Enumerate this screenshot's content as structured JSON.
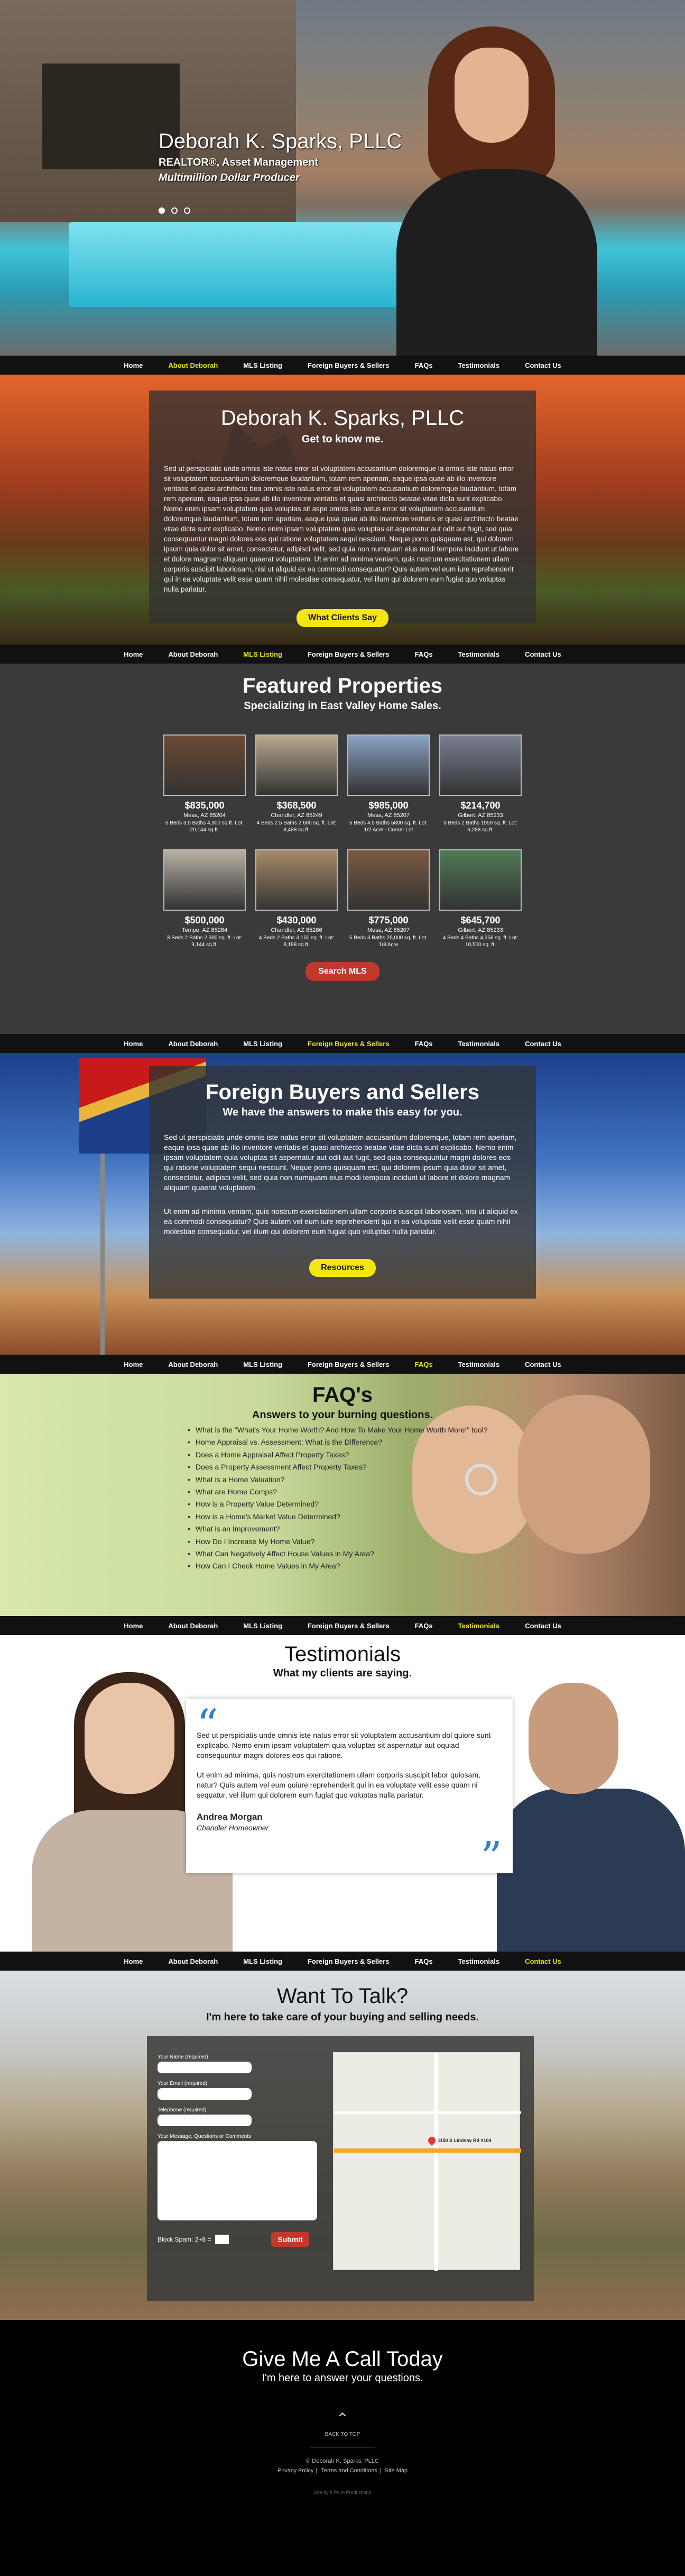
{
  "nav": [
    "Home",
    "About Deborah",
    "MLS Listing",
    "Foreign Buyers & Sellers",
    "FAQs",
    "Testimonials",
    "Contact Us"
  ],
  "hero": {
    "name": "Deborah K. Sparks, PLLC",
    "title": "REALTOR®, Asset Management",
    "tagline": "Multimillion Dollar Producer"
  },
  "about": {
    "heading": "Deborah K. Sparks, PLLC",
    "subheading": "Get to know me.",
    "body": "Sed ut perspiciatis unde omnis iste natus error sit voluptatem accusantium doloremque la omnis iste natus error sit voluptatem accusantium doloremque laudantium, totam rem aperiam, eaque ipsa quae ab illo inventore veritatis et quasi architecto bea omnis iste natus error sit voluptatem accusantium doloremque laudantium, totam rem aperiam, eaque ipsa quae ab illo inventore veritatis et quasi architecto beatae vitae dicta sunt explicabo. Nemo enim ipsam voluptatem quia voluptas sit aspe omnis iste natus error sit voluptatem accusantium doloremque laudantium, totam rem aperiam, eaque ipsa quae ab illo inventore veritatis et quasi architecto beatae vitae dicta sunt explicabo. Nemo enim ipsam voluptatem quia voluptas sit aspernatur aut odit aut fugit, sed quia consequuntur magni dolores eos qui ratione voluptatem sequi nesciunt. Neque porro quisquam est, qui dolorem ipsum quia dolor sit amet, consectetur, adipisci velit, sed quia non numquam eius modi tempora incidunt ut labore et dolore magnam aliquam quaerat voluptatem. Ut enim ad minima veniam, quis nostrum exercitationem ullam corporis suscipit laboriosam, nisi ut aliquid ex ea commodi consequatur? Quis autem vel eum iure reprehenderit qui in ea voluptate velit esse quam nihil molestiae consequatur, vel illum qui dolorem eum fugiat quo voluptas nulla pariatur.",
    "button": "What Clients Say"
  },
  "props": {
    "heading": "Featured Properties",
    "subheading": "Specializing in East Valley Home Sales.",
    "button": "Search MLS",
    "items": [
      {
        "price": "$835,000",
        "addr": "Mesa, AZ 85204",
        "det": "5 Beds 3.5 Baths 4,300 sq.ft. Lot: 20,144 sq.ft."
      },
      {
        "price": "$368,500",
        "addr": "Chandler, AZ 85249",
        "det": "4 Beds 2.5 Baths 2,600 sq. ft. Lot: 8,488 sq.ft."
      },
      {
        "price": "$985,000",
        "addr": "Mesa, AZ 85207",
        "det": "5 Beds 4.5 Baths 5800 sq. ft. Lot: 1/2 Acre - Corner Lot"
      },
      {
        "price": "$214,700",
        "addr": "Gilbert, AZ 85233",
        "det": "3 Beds 2 Baths 1950 sq. ft. Lot: 6,288 sq.ft."
      },
      {
        "price": "$500,000",
        "addr": "Tempe, AZ 85284",
        "det": "3 Beds 2 Baths 2,300 sq. ft. Lot: 9,144 sq.ft."
      },
      {
        "price": "$430,000",
        "addr": "Chandler, AZ 85286",
        "det": "4 Beds 2 Baths 3,150 sq. ft. Lot: 8,188 sq.ft."
      },
      {
        "price": "$775,000",
        "addr": "Mesa, AZ 85207",
        "det": "5 Beds 3 Baths 25,000 sq. ft. Lot: 1/3 Acre"
      },
      {
        "price": "$645,700",
        "addr": "Gilbert, AZ 85233",
        "det": "4 Beds 4 Baths 4,256 sq. ft. Lot: 10,500 sq. ft."
      }
    ]
  },
  "foreign": {
    "heading": "Foreign Buyers and Sellers",
    "subheading": "We have the answers to make this easy for you.",
    "p1": "Sed ut perspiciatis unde omnis iste natus error sit voluptatem accusantium doloremque, totam rem aperiam, eaque ipsa quae ab illo inventore veritatis et quasi architecto beatae vitae dicta sunt explicabo. Nemo enim ipsam voluptatem quia voluptas sit aspernatur aut odit aut fugit, sed quia consequuntur magni dolores eos qui ratione voluptatem sequi nesciunt. Neque porro quisquam est, qui dolorem ipsum quia dolor sit amet, consectetur, adipisci velit, sed quia non numquam eius modi tempora incidunt ut labore et dolore magnam aliquam quaerat voluptatem.",
    "p2": "Ut enim ad minima veniam, quis nostrum exercitationem ullam corporis suscipit laboriosam, nisi ut aliquid ex ea commodi consequatur? Quis autem vel eum iure reprehenderit qui in ea voluptate velit esse quam nihil molestiae consequatur, vel illum qui dolorem eum fugiat quo voluptas nulla pariatur.",
    "button": "Resources"
  },
  "faq": {
    "heading": "FAQ's",
    "subheading": "Answers to your burning questions.",
    "items": [
      "What is the \"What's Your Home Worth? And How To Make Your Home Worth More!\" tool?",
      "Home Appraisal vs. Assessment: What is the Difference?",
      "Does a Home Appraisal Affect Property Taxes?",
      "Does a Property Assessment Affect Property Taxes?",
      "What is a Home Valuation?",
      "What are Home Comps?",
      "How is a Property Value Determined?",
      "How is a Home's Market Value Determined?",
      "What is an Improvement?",
      "How Do I Increase My Home Value?",
      "What Can Negatively Affect House Values in My Area?",
      "How Can I Check Home Values in My Area?"
    ]
  },
  "testi": {
    "heading": "Testimonials",
    "subheading": "What my clients are saying.",
    "p1": "Sed ut perspiciatis unde omnis iste natus error sit voluptatem accusantium dol quiore sunt explicabo. Nemo enim ipsam voluptatem quia voluptas sit aspernatur aut oquiad consequuntur magni dolores eos qui ratione.",
    "p2": "Ut enim ad minima, quis nostrum exercitationem ullam corporis suscipit labor quiosam, natur? Quis autem vel eum quiure reprehenderit qui in ea voluptate velit esse quam ni sequatur, vel illum qui dolorem eum fugiat quo voluptas nulla pariatur.",
    "name": "Andrea Morgan",
    "role": "Chandler Homeowner"
  },
  "contact": {
    "heading": "Want To Talk?",
    "subheading": "I'm here to take care of your buying and selling needs.",
    "labels": {
      "name": "Your Name (required)",
      "email": "Your Email (required)",
      "phone": "Telephone (required)",
      "message": "Your Message, Questions or Comments"
    },
    "captcha": "Block Spam: 2+8 =",
    "submit": "Submit",
    "map_label": "1150 S Lindsay Rd #104"
  },
  "footer": {
    "heading": "Give Me A Call Today",
    "subheading": "I'm here to answer your questions.",
    "back": "BACK TO TOP",
    "copy": "© Deborah K. Sparks, PLLC",
    "links": [
      "Privacy Policy",
      "Terms and Conditions",
      "Site Map"
    ],
    "site": "Site by 8 Point Productions"
  }
}
